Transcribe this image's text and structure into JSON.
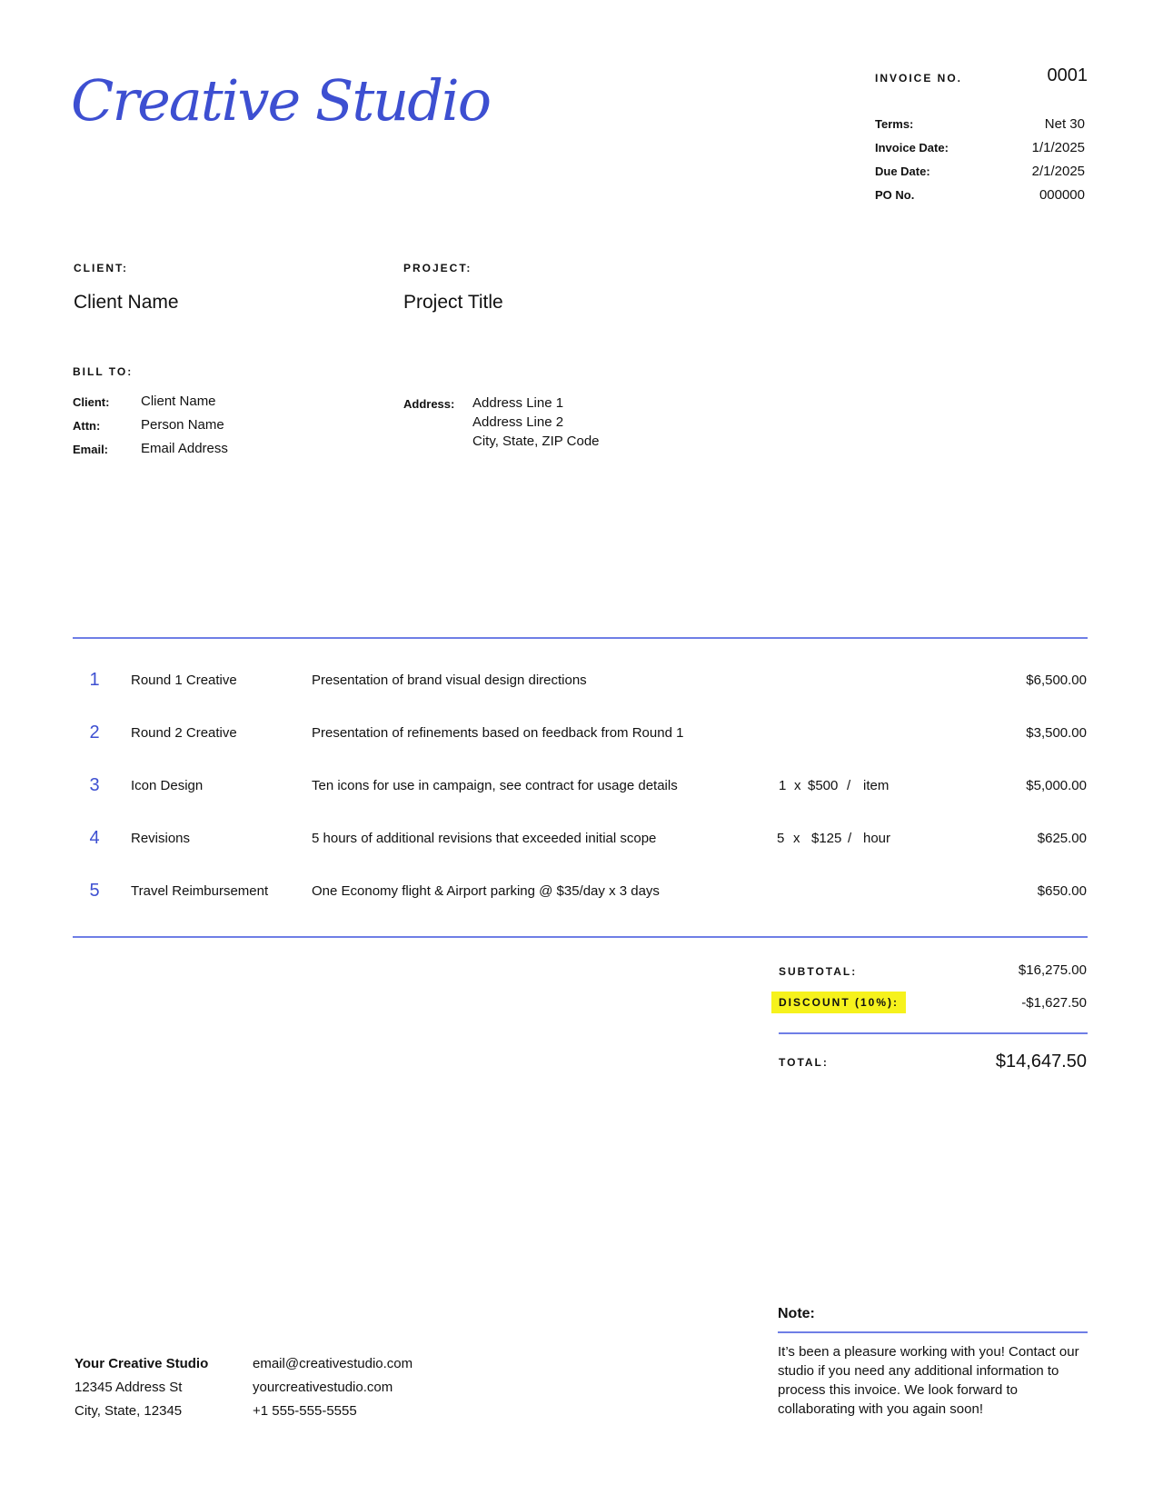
{
  "brand": {
    "logo_text": "Creative Studio"
  },
  "invoice": {
    "number_label": "INVOICE NO.",
    "number": "0001",
    "meta": [
      {
        "label": "Terms:",
        "value": "Net 30"
      },
      {
        "label": "Invoice Date:",
        "value": "1/1/2025"
      },
      {
        "label": "Due Date:",
        "value": "2/1/2025"
      },
      {
        "label": "PO No.",
        "value": "000000"
      }
    ]
  },
  "client": {
    "label": "CLIENT:",
    "value": "Client Name"
  },
  "project": {
    "label": "PROJECT:",
    "value": "Project Title"
  },
  "bill_to": {
    "label": "BILL TO:",
    "client_label": "Client:",
    "client": "Client Name",
    "attn_label": "Attn:",
    "attn": "Person Name",
    "email_label": "Email:",
    "email": "Email Address",
    "address_label": "Address:",
    "address_line1": "Address Line 1",
    "address_line2": "Address Line 2",
    "address_line3": "City, State, ZIP Code"
  },
  "line_items": [
    {
      "num": "1",
      "name": "Round 1 Creative",
      "desc": "Presentation of brand visual design directions",
      "qty": "",
      "x": "",
      "rate": "",
      "slash": "",
      "unit": "",
      "amount": "$6,500.00"
    },
    {
      "num": "2",
      "name": "Round 2 Creative",
      "desc": "Presentation of refinements based on feedback from Round 1",
      "qty": "",
      "x": "",
      "rate": "",
      "slash": "",
      "unit": "",
      "amount": "$3,500.00"
    },
    {
      "num": "3",
      "name": "Icon Design",
      "desc": "Ten icons for use in campaign, see contract for usage details",
      "qty": "1",
      "x": "x",
      "rate": "$500",
      "slash": "/",
      "unit": "item",
      "amount": "$5,000.00"
    },
    {
      "num": "4",
      "name": "Revisions",
      "desc": "5 hours of additional revisions that exceeded initial scope",
      "qty": "5",
      "x": "x",
      "rate": "$125",
      "slash": "/",
      "unit": "hour",
      "amount": "$625.00"
    },
    {
      "num": "5",
      "name": "Travel Reimbursement",
      "desc": "One Economy flight & Airport parking @ $35/day x 3 days",
      "qty": "",
      "x": "",
      "rate": "",
      "slash": "",
      "unit": "",
      "amount": "$650.00"
    }
  ],
  "totals": {
    "subtotal_label": "SUBTOTAL:",
    "subtotal": "$16,275.00",
    "discount_label": "DISCOUNT (10%):",
    "discount": "-$1,627.50",
    "total_label": "TOTAL:",
    "total": "$14,647.50"
  },
  "footer": {
    "studio_name": "Your Creative Studio",
    "address1": "12345 Address St",
    "address2": "City, State, 12345",
    "email": "email@creativestudio.com",
    "website": "yourcreativestudio.com",
    "phone": "+1 555-555-5555"
  },
  "note": {
    "label": "Note:",
    "text": "It’s been a pleasure working with you! Contact our studio if you need any additional information to process this invoice. We look forward to collaborating with you again soon!"
  },
  "colors": {
    "accent": "#3d4fd1",
    "rule": "#6f7ee6",
    "highlight": "#f6f21c"
  }
}
